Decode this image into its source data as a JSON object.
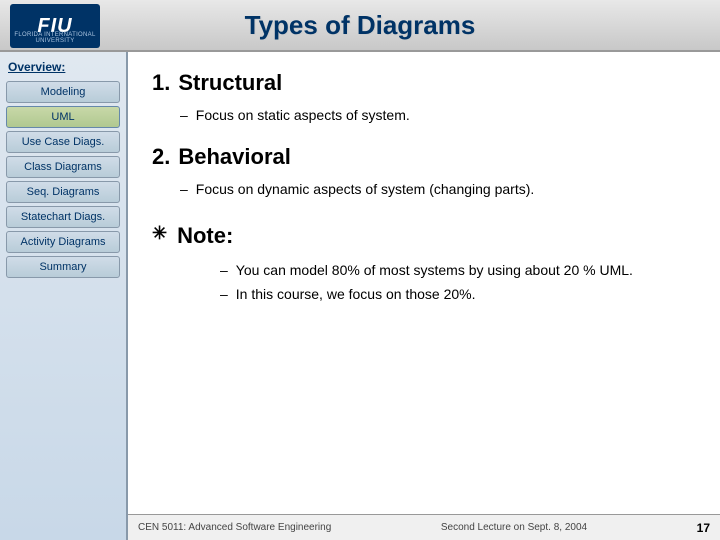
{
  "header": {
    "title": "Types of Diagrams",
    "logo_text": "FIU",
    "logo_sub": "FLORIDA INTERNATIONAL UNIVERSITY"
  },
  "sidebar": {
    "overview_label": "Overview:",
    "items": [
      {
        "label": "Modeling",
        "active": false,
        "highlight": false
      },
      {
        "label": "UML",
        "active": false,
        "highlight": true
      },
      {
        "label": "Use Case Diags.",
        "active": false,
        "highlight": false
      },
      {
        "label": "Class Diagrams",
        "active": false,
        "highlight": false
      },
      {
        "label": "Seq. Diagrams",
        "active": false,
        "highlight": false
      },
      {
        "label": "Statechart Diags.",
        "active": false,
        "highlight": false
      },
      {
        "label": "Activity Diagrams",
        "active": false,
        "highlight": false
      },
      {
        "label": "Summary",
        "active": false,
        "highlight": false
      }
    ]
  },
  "content": {
    "section1": {
      "number": "1.",
      "title": "Structural",
      "bullets": [
        {
          "dash": "–",
          "text": "Focus on static aspects of system."
        }
      ]
    },
    "section2": {
      "number": "2.",
      "title": "Behavioral",
      "bullets": [
        {
          "dash": "–",
          "text": "Focus on dynamic aspects of system (changing parts)."
        }
      ]
    },
    "note": {
      "star": "✳",
      "title": "Note:",
      "bullets": [
        {
          "dash": "–",
          "text": "You can model 80% of most systems by using about 20 % UML."
        },
        {
          "dash": "–",
          "text": "In this course, we focus on those 20%."
        }
      ]
    }
  },
  "footer": {
    "course": "CEN 5011: Advanced Software Engineering",
    "lecture": "Second Lecture on Sept. 8, 2004",
    "page": "17"
  }
}
